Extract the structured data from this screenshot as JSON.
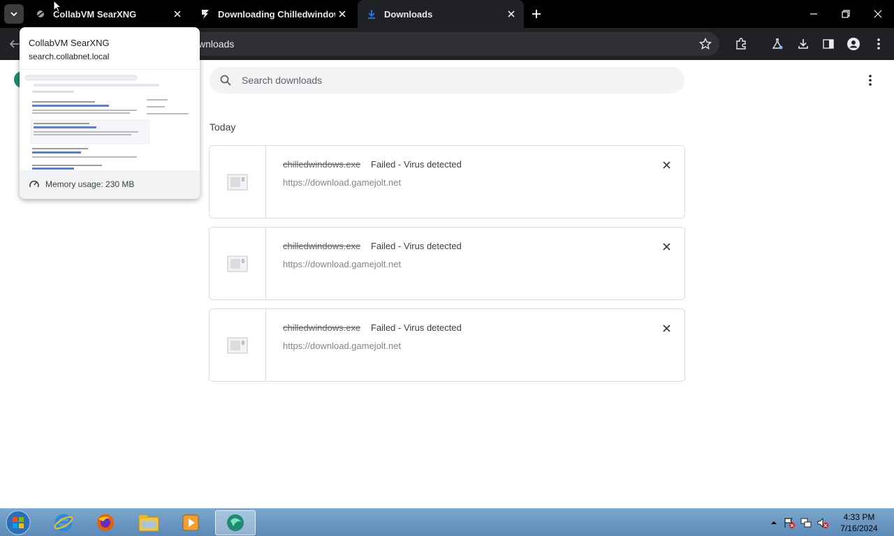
{
  "tabs": [
    {
      "title": "CollabVM SearXNG",
      "icon": "searxng-icon"
    },
    {
      "title": "Downloading Chilledwindows...",
      "icon": "gamejolt-icon"
    },
    {
      "title": "Downloads",
      "icon": "download-icon",
      "active": true
    }
  ],
  "omnibox": {
    "text": "wnloads"
  },
  "search": {
    "placeholder": "Search downloads"
  },
  "section": {
    "title": "Today"
  },
  "downloads": [
    {
      "filename": "chilledwindows.exe",
      "status": "Failed - Virus detected",
      "url": "https://download.gamejolt.net"
    },
    {
      "filename": "chilledwindows.exe",
      "status": "Failed - Virus detected",
      "url": "https://download.gamejolt.net"
    },
    {
      "filename": "chilledwindows.exe",
      "status": "Failed - Virus detected",
      "url": "https://download.gamejolt.net"
    }
  ],
  "hovercard": {
    "title": "CollabVM SearXNG",
    "domain": "search.collabnet.local",
    "memory": "Memory usage: 230 MB"
  },
  "clock": {
    "time": "4:33 PM",
    "date": "7/16/2024"
  },
  "colors": {
    "accent": "#1a73e8",
    "tabbar": "#000000",
    "toolbar": "#202124"
  }
}
